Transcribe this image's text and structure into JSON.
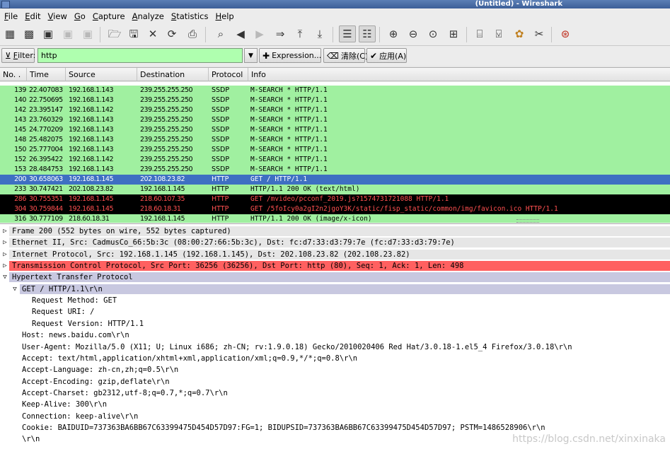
{
  "window": {
    "title": "(Untitled) - Wireshark"
  },
  "menu": [
    {
      "acc": "F",
      "rest": "ile"
    },
    {
      "acc": "E",
      "rest": "dit"
    },
    {
      "acc": "V",
      "rest": "iew"
    },
    {
      "acc": "G",
      "rest": "o"
    },
    {
      "acc": "C",
      "rest": "apture"
    },
    {
      "acc": "A",
      "rest": "nalyze"
    },
    {
      "acc": "S",
      "rest": "tatistics"
    },
    {
      "acc": "H",
      "rest": "elp"
    }
  ],
  "filter": {
    "label_acc": "F",
    "label_rest": "ilter:",
    "value": "http",
    "expression_label": "Expression...",
    "clear_label": "清除(C)",
    "apply_label": "应用(A)"
  },
  "columns": [
    "No. .",
    "Time",
    "Source",
    "Destination",
    "Protocol",
    "Info"
  ],
  "colors": {
    "ssdp_bg": "#a0f0a0",
    "http_bg": "#a0f0a0",
    "selected_bg": "#3e6fc2",
    "error_bg": "#000000",
    "error_fg": "#ff5050",
    "tcp_bg": "#ff6060",
    "expanded_bg": "#c8c8e0"
  },
  "packets": [
    {
      "no": "139",
      "time": "22.407083",
      "src": "192.168.1.143",
      "dst": "239.255.255.250",
      "proto": "SSDP",
      "info": "M-SEARCH * HTTP/1.1",
      "style": "green"
    },
    {
      "no": "140",
      "time": "22.750695",
      "src": "192.168.1.143",
      "dst": "239.255.255.250",
      "proto": "SSDP",
      "info": "M-SEARCH * HTTP/1.1",
      "style": "green"
    },
    {
      "no": "142",
      "time": "23.395147",
      "src": "192.168.1.142",
      "dst": "239.255.255.250",
      "proto": "SSDP",
      "info": "M-SEARCH * HTTP/1.1",
      "style": "green"
    },
    {
      "no": "143",
      "time": "23.760329",
      "src": "192.168.1.143",
      "dst": "239.255.255.250",
      "proto": "SSDP",
      "info": "M-SEARCH * HTTP/1.1",
      "style": "green"
    },
    {
      "no": "145",
      "time": "24.770209",
      "src": "192.168.1.143",
      "dst": "239.255.255.250",
      "proto": "SSDP",
      "info": "M-SEARCH * HTTP/1.1",
      "style": "green"
    },
    {
      "no": "148",
      "time": "25.482075",
      "src": "192.168.1.143",
      "dst": "239.255.255.250",
      "proto": "SSDP",
      "info": "M-SEARCH * HTTP/1.1",
      "style": "green"
    },
    {
      "no": "150",
      "time": "25.777004",
      "src": "192.168.1.143",
      "dst": "239.255.255.250",
      "proto": "SSDP",
      "info": "M-SEARCH * HTTP/1.1",
      "style": "green"
    },
    {
      "no": "152",
      "time": "26.395422",
      "src": "192.168.1.142",
      "dst": "239.255.255.250",
      "proto": "SSDP",
      "info": "M-SEARCH * HTTP/1.1",
      "style": "green"
    },
    {
      "no": "153",
      "time": "28.484753",
      "src": "192.168.1.143",
      "dst": "239.255.255.250",
      "proto": "SSDP",
      "info": "M-SEARCH * HTTP/1.1",
      "style": "green"
    },
    {
      "no": "200",
      "time": "30.658063",
      "src": "192.168.1.145",
      "dst": "202.108.23.82",
      "proto": "HTTP",
      "info": "GET / HTTP/1.1",
      "style": "selected"
    },
    {
      "no": "233",
      "time": "30.747421",
      "src": "202.108.23.82",
      "dst": "192.168.1.145",
      "proto": "HTTP",
      "info": "HTTP/1.1 200 OK  (text/html)",
      "style": "green"
    },
    {
      "no": "286",
      "time": "30.755351",
      "src": "192.168.1.145",
      "dst": "218.60.107.35",
      "proto": "HTTP",
      "info": "GET /mvideo/pcconf_2019.js?1574731721088 HTTP/1.1",
      "style": "error"
    },
    {
      "no": "304",
      "time": "30.759844",
      "src": "192.168.1.145",
      "dst": "218.60.18.31",
      "proto": "HTTP",
      "info": "GET /5foIcy0a2gI2n2jgoY3K/static/fisp_static/common/img/favicon.ico HTTP/1.1",
      "style": "error"
    },
    {
      "no": "316",
      "time": "30.777109",
      "src": "218.60.18.31",
      "dst": "192.168.1.145",
      "proto": "HTTP",
      "info": "HTTP/1.1 200 OK  (image/x-icon)",
      "style": "green"
    }
  ],
  "details": [
    {
      "text": "Frame 200 (552 bytes on wire, 552 bytes captured)",
      "indent": 0,
      "expander": "collapsed",
      "style": "gray"
    },
    {
      "text": "Ethernet II, Src: CadmusCo_66:5b:3c (08:00:27:66:5b:3c), Dst: fc:d7:33:d3:79:7e (fc:d7:33:d3:79:7e)",
      "indent": 0,
      "expander": "collapsed",
      "style": "gray"
    },
    {
      "text": "Internet Protocol, Src: 192.168.1.145 (192.168.1.145), Dst: 202.108.23.82 (202.108.23.82)",
      "indent": 0,
      "expander": "collapsed",
      "style": "gray"
    },
    {
      "text": "Transmission Control Protocol, Src Port: 36256 (36256), Dst Port: http (80), Seq: 1, Ack: 1, Len: 498",
      "indent": 0,
      "expander": "collapsed",
      "style": "tcp"
    },
    {
      "text": "Hypertext Transfer Protocol",
      "indent": 0,
      "expander": "expanded",
      "style": "expanded"
    },
    {
      "text": "GET / HTTP/1.1\\r\\n",
      "indent": 1,
      "expander": "expanded",
      "style": "expanded"
    },
    {
      "text": "Request Method: GET",
      "indent": 3,
      "expander": "",
      "style": "plain"
    },
    {
      "text": "Request URI: /",
      "indent": 3,
      "expander": "",
      "style": "plain"
    },
    {
      "text": "Request Version: HTTP/1.1",
      "indent": 3,
      "expander": "",
      "style": "plain"
    },
    {
      "text": "Host: news.baidu.com\\r\\n",
      "indent": 2,
      "expander": "",
      "style": "plain"
    },
    {
      "text": "User-Agent: Mozilla/5.0 (X11; U; Linux i686; zh-CN; rv:1.9.0.18) Gecko/2010020406 Red Hat/3.0.18-1.el5_4 Firefox/3.0.18\\r\\n",
      "indent": 2,
      "expander": "",
      "style": "plain"
    },
    {
      "text": "Accept: text/html,application/xhtml+xml,application/xml;q=0.9,*/*;q=0.8\\r\\n",
      "indent": 2,
      "expander": "",
      "style": "plain"
    },
    {
      "text": "Accept-Language: zh-cn,zh;q=0.5\\r\\n",
      "indent": 2,
      "expander": "",
      "style": "plain"
    },
    {
      "text": "Accept-Encoding: gzip,deflate\\r\\n",
      "indent": 2,
      "expander": "",
      "style": "plain"
    },
    {
      "text": "Accept-Charset: gb2312,utf-8;q=0.7,*;q=0.7\\r\\n",
      "indent": 2,
      "expander": "",
      "style": "plain"
    },
    {
      "text": "Keep-Alive: 300\\r\\n",
      "indent": 2,
      "expander": "",
      "style": "plain"
    },
    {
      "text": "Connection: keep-alive\\r\\n",
      "indent": 2,
      "expander": "",
      "style": "plain"
    },
    {
      "text": "Cookie: BAIDUID=737363BA6BB67C63399475D454D57D97:FG=1; BIDUPSID=737363BA6BB67C63399475D454D57D97; PSTM=1486528906\\r\\n",
      "indent": 2,
      "expander": "",
      "style": "plain"
    },
    {
      "text": "\\r\\n",
      "indent": 2,
      "expander": "",
      "style": "plain"
    }
  ],
  "watermark": "https://blog.csdn.net/xinxinaka"
}
